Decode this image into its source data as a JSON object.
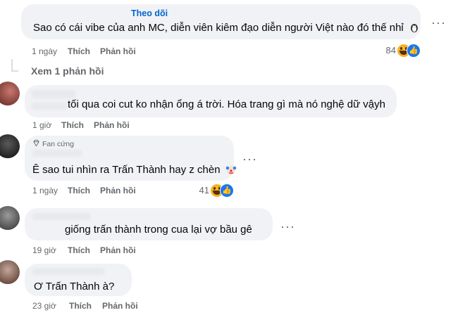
{
  "comments": [
    {
      "follow_label": "Theo dõi",
      "text": "Sao có cái vibe của anh MC, diễn viên kiêm đạo diễn người Việt nào đó thế nhỉ",
      "time": "1 ngày",
      "like_label": "Thích",
      "reply_label": "Phản hồi",
      "reaction_count": "84"
    },
    {
      "text": "tối qua coi cut ko nhận ổng á trời. Hóa trang gì mà nó nghệ dữ vậyh",
      "time": "1 giờ",
      "like_label": "Thích",
      "reply_label": "Phản hồi"
    },
    {
      "badge": "Fan cứng",
      "text": "Ê sao tui nhìn ra Trấn Thành hay z chèn",
      "time": "1 ngày",
      "like_label": "Thích",
      "reply_label": "Phản hồi",
      "reaction_count": "41"
    },
    {
      "text": "giống trấn thành trong cua lại vợ bầu gê",
      "time": "19 giờ",
      "like_label": "Thích",
      "reply_label": "Phản hồi"
    },
    {
      "text": "Ơ Trấn Thành à?",
      "time": "23 giờ",
      "like_label": "Thích",
      "reply_label": "Phản hồi"
    }
  ],
  "view_replies": "Xem 1 phản hồi",
  "icons": [
    "more-options-icon",
    "penguin-emoji-icon",
    "haha-reaction-icon",
    "like-reaction-icon",
    "clown-emoji-icon",
    "diamond-badge-icon"
  ],
  "colors": {
    "bubble": "#f0f2f5",
    "meta": "#65676b",
    "link": "#0064d1",
    "like": "#1877f2",
    "haha": "#f7b125"
  }
}
